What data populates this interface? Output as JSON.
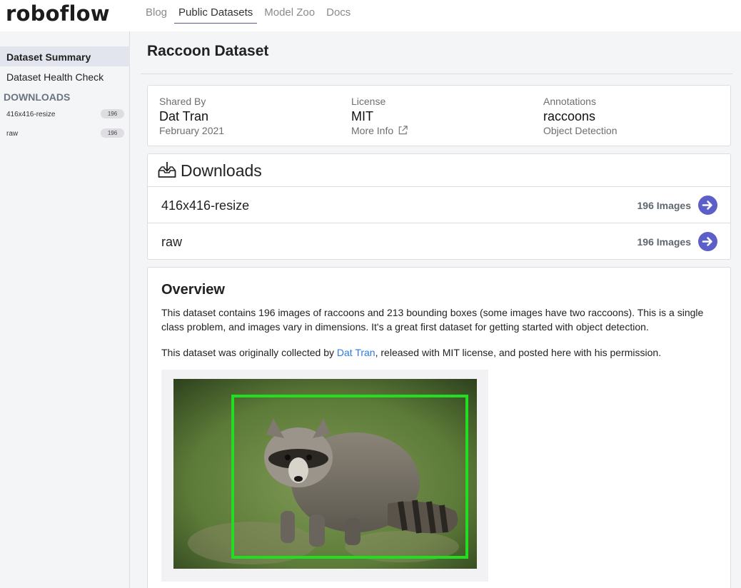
{
  "brand": {
    "logo": "roboflow"
  },
  "nav": {
    "items": [
      "Blog",
      "Public Datasets",
      "Model Zoo",
      "Docs"
    ],
    "active": "Public Datasets"
  },
  "sidebar": {
    "items": [
      "Dataset Summary",
      "Dataset Health Check"
    ],
    "active": "Dataset Summary",
    "downloads_heading": "DOWNLOADS",
    "downloads": [
      {
        "name": "416x416-resize",
        "count": "196"
      },
      {
        "name": "raw",
        "count": "196"
      }
    ]
  },
  "page": {
    "title": "Raccoon Dataset"
  },
  "info": {
    "shared_by": {
      "label": "Shared By",
      "value": "Dat Tran",
      "sub": "February 2021"
    },
    "license": {
      "label": "License",
      "value": "MIT",
      "sub": "More Info"
    },
    "annotations": {
      "label": "Annotations",
      "value": "raccoons",
      "sub": "Object Detection"
    }
  },
  "downloads": {
    "title": "Downloads",
    "rows": [
      {
        "name": "416x416-resize",
        "count": "196 Images"
      },
      {
        "name": "raw",
        "count": "196 Images"
      }
    ]
  },
  "overview": {
    "title": "Overview",
    "paragraph1": "This dataset contains 196 images of raccoons and 213 bounding boxes (some images have two raccoons). This is a single class problem, and images vary in dimensions. It's a great first dataset for getting started with object detection.",
    "paragraph2_before": "This dataset was originally collected by ",
    "paragraph2_link": "Dat Tran",
    "paragraph2_after": ", released with MIT license, and posted here with his permission."
  },
  "colors": {
    "accent": "#5b5fc7",
    "link": "#2a7ae2",
    "bbox": "#22dd22",
    "sidebar_active": "#e2e4ee"
  },
  "icons": [
    "download-icon",
    "external-link-icon",
    "arrow-right-circle-icon"
  ]
}
